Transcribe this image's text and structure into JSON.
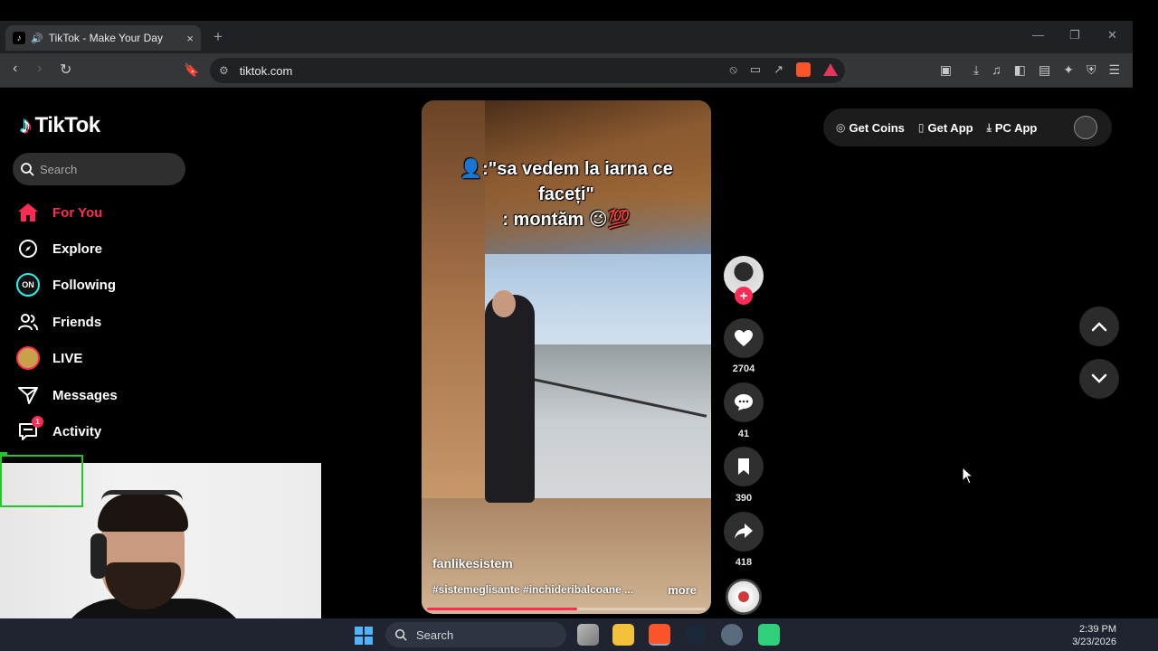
{
  "browser": {
    "tab_title": "TikTok - Make Your Day",
    "tab_close": "×",
    "new_tab": "+",
    "url": "tiktok.com"
  },
  "sidebar": {
    "logo_text": "TikTok",
    "search_placeholder": "Search",
    "items": [
      {
        "label": "For You",
        "icon": "home-icon",
        "active": true
      },
      {
        "label": "Explore",
        "icon": "compass-icon"
      },
      {
        "label": "Following",
        "icon": "following-avatar-icon"
      },
      {
        "label": "Friends",
        "icon": "friends-icon"
      },
      {
        "label": "LIVE",
        "icon": "live-avatar-icon"
      },
      {
        "label": "Messages",
        "icon": "paper-plane-icon"
      },
      {
        "label": "Activity",
        "icon": "inbox-icon",
        "badge": "1"
      }
    ]
  },
  "video": {
    "caption_line1": "👤:\"sa vedem la iarna ce",
    "caption_line2": "faceți\"",
    "caption_line3": ": montăm 😉💯",
    "author": "fanlikesistem",
    "hashtags": "#sistemeglisante #inchideribalcoane ...",
    "more_label": "more",
    "progress": 0.54
  },
  "actions": {
    "likes": "2704",
    "comments": "41",
    "saves": "390",
    "shares": "418"
  },
  "topbar": {
    "get_coins": "Get Coins",
    "get_app": "Get App",
    "pc_app": "PC App"
  },
  "taskbar": {
    "search_placeholder": "Search",
    "time": "2:39 PM",
    "date": "3/23/2026"
  },
  "colors": {
    "accent": "#fe2c55",
    "tiktok_cyan": "#25f4ee",
    "browser_chrome": "#35363a",
    "taskbar": "#1f2430"
  }
}
